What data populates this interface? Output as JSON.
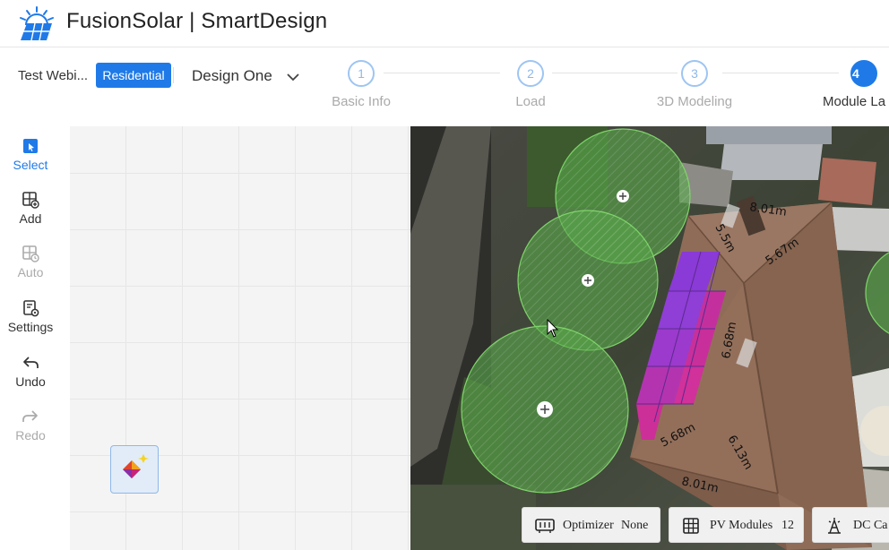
{
  "app": {
    "title": "FusionSolar | SmartDesign"
  },
  "project": {
    "name": "Test Webi...",
    "type_badge": "Residential",
    "design_name": "Design One"
  },
  "steps": [
    {
      "number": "1",
      "label": "Basic Info"
    },
    {
      "number": "2",
      "label": "Load"
    },
    {
      "number": "3",
      "label": "3D Modeling"
    },
    {
      "number": "4",
      "label": "Module La"
    }
  ],
  "tools": {
    "select": "Select",
    "add": "Add",
    "auto": "Auto",
    "settings": "Settings",
    "undo": "Undo",
    "redo": "Redo"
  },
  "measurements": {
    "top": "8.01m",
    "slant_left": "5.5m",
    "ridge_right": "5.67m",
    "mid": "6.68m",
    "bottom_left": "5.68m",
    "bottom_right": "6.13m",
    "bottom": "8.01m"
  },
  "bottom_bar": {
    "optimizer_label": "Optimizer",
    "optimizer_value": "None",
    "pv_modules_label": "PV Modules",
    "pv_modules_count": "12",
    "dc_label": "DC Ca"
  },
  "colors": {
    "accent": "#1f7ae8",
    "tree_green": "#4caf50",
    "module_purple": "#8a3ad6",
    "module_pink": "#d1319a"
  }
}
